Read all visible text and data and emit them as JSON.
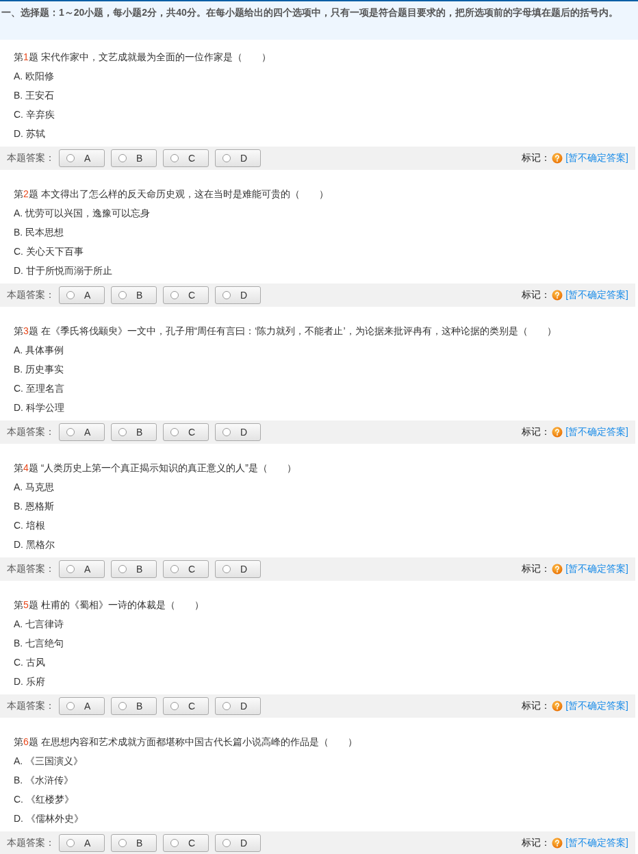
{
  "section_header": "一、选择题：1～20小题，每小题2分，共40分。在每小题给出的四个选项中，只有一项是符合题目要求的，把所选项前的字母填在题后的括号内。",
  "questions": [
    {
      "prefix": "第",
      "number": "1",
      "suffix": "题",
      "text": "宋代作家中，文艺成就最为全面的一位作家是（　　）",
      "options": [
        "A. 欧阳修",
        "B. 王安石",
        "C. 辛弃疾",
        "D. 苏轼"
      ],
      "answer_label": "本题答案：",
      "choices": [
        {
          "label": "A",
          "selected": false
        },
        {
          "label": "B",
          "selected": false
        },
        {
          "label": "C",
          "selected": false
        },
        {
          "label": "D",
          "selected": false
        }
      ],
      "mark_label": "标记：",
      "unsure_link": "[暂不确定答案]"
    },
    {
      "prefix": "第",
      "number": "2",
      "suffix": "题",
      "text": "本文得出了怎么样的反天命历史观，这在当时是难能可贵的（　　）",
      "options": [
        "A. 忧劳可以兴国，逸豫可以忘身",
        "B. 民本思想",
        "C. 关心天下百事",
        "D. 甘于所悦而溺于所止"
      ],
      "answer_label": "本题答案：",
      "choices": [
        {
          "label": "A",
          "selected": false
        },
        {
          "label": "B",
          "selected": false
        },
        {
          "label": "C",
          "selected": false
        },
        {
          "label": "D",
          "selected": false
        }
      ],
      "mark_label": "标记：",
      "unsure_link": "[暂不确定答案]"
    },
    {
      "prefix": "第",
      "number": "3",
      "suffix": "题",
      "text": "在《季氏将伐颛臾》一文中，孔子用“周任有言曰：‘陈力就列，不能者止’，为论据来批评冉有，这种论据的类别是（　　）",
      "options": [
        "A. 具体事例",
        "B. 历史事实",
        "C. 至理名言",
        "D. 科学公理"
      ],
      "answer_label": "本题答案：",
      "choices": [
        {
          "label": "A",
          "selected": false
        },
        {
          "label": "B",
          "selected": false
        },
        {
          "label": "C",
          "selected": false
        },
        {
          "label": "D",
          "selected": false
        }
      ],
      "mark_label": "标记：",
      "unsure_link": "[暂不确定答案]"
    },
    {
      "prefix": "第",
      "number": "4",
      "suffix": "题",
      "text": "“人类历史上第一个真正揭示知识的真正意义的人”是（　　）",
      "options": [
        "A. 马克思",
        "B. 恩格斯",
        "C. 培根",
        "D. 黑格尔"
      ],
      "answer_label": "本题答案：",
      "choices": [
        {
          "label": "A",
          "selected": false
        },
        {
          "label": "B",
          "selected": false
        },
        {
          "label": "C",
          "selected": false
        },
        {
          "label": "D",
          "selected": false
        }
      ],
      "mark_label": "标记：",
      "unsure_link": "[暂不确定答案]"
    },
    {
      "prefix": "第",
      "number": "5",
      "suffix": "题",
      "text": "杜甫的《蜀相》一诗的体裁是（　　）",
      "options": [
        "A. 七言律诗",
        "B. 七言绝句",
        "C. 古风",
        "D. 乐府"
      ],
      "answer_label": "本题答案：",
      "choices": [
        {
          "label": "A",
          "selected": false
        },
        {
          "label": "B",
          "selected": false
        },
        {
          "label": "C",
          "selected": false
        },
        {
          "label": "D",
          "selected": false
        }
      ],
      "mark_label": "标记：",
      "unsure_link": "[暂不确定答案]"
    },
    {
      "prefix": "第",
      "number": "6",
      "suffix": "题",
      "text": "在思想内容和艺术成就方面都堪称中国古代长篇小说高峰的作品是（　　）",
      "options": [
        "A. 《三国演义》",
        "B. 《水浒传》",
        "C. 《红楼梦》",
        "D. 《儒林外史》"
      ],
      "answer_label": "本题答案：",
      "choices": [
        {
          "label": "A",
          "selected": false
        },
        {
          "label": "B",
          "selected": false
        },
        {
          "label": "C",
          "selected": false
        },
        {
          "label": "D",
          "selected": false
        }
      ],
      "mark_label": "标记：",
      "unsure_link": "[暂不确定答案]"
    }
  ]
}
